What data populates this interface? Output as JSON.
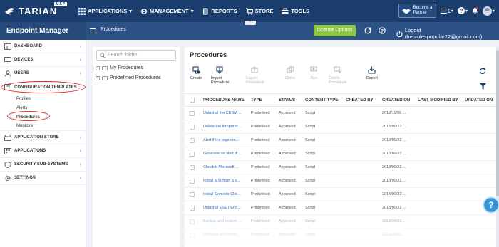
{
  "topbar": {
    "logo_text": "TARIAN",
    "logo_badge": "MSP",
    "nav": [
      {
        "label": "APPLICATIONS",
        "icon": "grid-icon",
        "chevron": true
      },
      {
        "label": "MANAGEMENT",
        "icon": "gear-icon",
        "chevron": true
      },
      {
        "label": "REPORTS",
        "icon": "document-icon",
        "chevron": false
      },
      {
        "label": "STORE",
        "icon": "cart-icon",
        "chevron": false
      },
      {
        "label": "TOOLS",
        "icon": "toolbox-icon",
        "chevron": false
      }
    ],
    "partner_line1": "Become a",
    "partner_line2": "Partner",
    "notify_count": "1"
  },
  "subbar": {
    "title": "Endpoint Manager",
    "breadcrumb": "Procedures",
    "license_button": "License Options",
    "logout": "Logout (herculespopular22@gmail.com)"
  },
  "sidebar": {
    "items": [
      {
        "label": "DASHBOARD",
        "icon": "dashboard-icon"
      },
      {
        "label": "DEVICES",
        "icon": "devices-icon"
      },
      {
        "label": "USERS",
        "icon": "user-icon"
      },
      {
        "label": "CONFIGURATION TEMPLATES",
        "icon": "config-icon"
      }
    ],
    "subitems": [
      "Profiles",
      "Alerts",
      "Procedures",
      "Monitors"
    ],
    "items_after": [
      {
        "label": "APPLICATION STORE",
        "icon": "store-icon"
      },
      {
        "label": "APPLICATIONS",
        "icon": "apps-icon"
      },
      {
        "label": "SECURITY SUB-SYSTEMS",
        "icon": "shield-icon"
      },
      {
        "label": "SETTINGS",
        "icon": "gear-icon"
      }
    ]
  },
  "tree": {
    "search_placeholder": "Search folder",
    "folders": [
      "My Procedures",
      "Predefined Procedures"
    ]
  },
  "main": {
    "title": "Procedures",
    "toolbar": [
      {
        "label": "Create",
        "enabled": true
      },
      {
        "label": "Import Procedure",
        "enabled": true
      },
      {
        "label": "Export Procedure",
        "enabled": false
      },
      {
        "label": "Clone",
        "enabled": false
      },
      {
        "label": "Run",
        "enabled": false
      },
      {
        "label": "Delete Procedure",
        "enabled": false
      },
      {
        "label": "Export",
        "enabled": true
      }
    ],
    "columns": [
      "PROCEDURE NAME",
      "TYPE",
      "STATUS",
      "CONTENT TYPE",
      "CREATED BY",
      "CREATED ON",
      "LAST MODIFIED BY",
      "UPDATED ON"
    ],
    "rows": [
      {
        "name": "Uninstall the CESM ...",
        "type": "Predefined",
        "status": "Approved",
        "content": "Script",
        "created_by": "",
        "created_on": "2018/11/06 ...",
        "modified_by": "",
        "updated_on": ""
      },
      {
        "name": "Delete the temporar...",
        "type": "Predefined",
        "status": "Approved",
        "content": "Script",
        "created_by": "",
        "created_on": "2018/09/22 ...",
        "modified_by": "",
        "updated_on": ""
      },
      {
        "name": "Alert if the logs cre...",
        "type": "Predefined",
        "status": "Approved",
        "content": "Script",
        "created_by": "",
        "created_on": "2018/09/22 ...",
        "modified_by": "",
        "updated_on": ""
      },
      {
        "name": "Generate an alert if ...",
        "type": "Predefined",
        "status": "Approved",
        "content": "Script",
        "created_by": "",
        "created_on": "2018/09/22 ...",
        "modified_by": "",
        "updated_on": ""
      },
      {
        "name": "Check if Microsoft ...",
        "type": "Predefined",
        "status": "Approved",
        "content": "Script",
        "created_by": "",
        "created_on": "2018/09/22 ...",
        "modified_by": "",
        "updated_on": ""
      },
      {
        "name": "Install MSI from a s...",
        "type": "Predefined",
        "status": "Approved",
        "content": "Script",
        "created_by": "",
        "created_on": "2018/09/22 ...",
        "modified_by": "",
        "updated_on": ""
      },
      {
        "name": "Install Comodo Clie...",
        "type": "Predefined",
        "status": "Approved",
        "content": "Script",
        "created_by": "",
        "created_on": "2018/09/22 ...",
        "modified_by": "",
        "updated_on": ""
      },
      {
        "name": "Uninstall ESET End...",
        "type": "Predefined",
        "status": "Approved",
        "content": "Script",
        "created_by": "",
        "created_on": "2018/09/22 ...",
        "modified_by": "",
        "updated_on": ""
      },
      {
        "name": "Backup and restore ...",
        "type": "Predefined",
        "status": "Approved",
        "content": "Script",
        "created_by": "",
        "created_on": "2018/09/22 ...",
        "modified_by": "",
        "updated_on": ""
      },
      {
        "name": "Uninstall and reinst...",
        "type": "Predefined",
        "status": "Approved",
        "content": "Script",
        "created_by": "",
        "created_on": "2018/09/22 ...",
        "modified_by": "",
        "updated_on": ""
      }
    ]
  },
  "help_label": "?",
  "colors": {
    "topbar": "#1a3d6d",
    "subbar": "#2c5286",
    "license": "#8dc63f",
    "link": "#2a6fbd",
    "annotation": "#e32222"
  }
}
